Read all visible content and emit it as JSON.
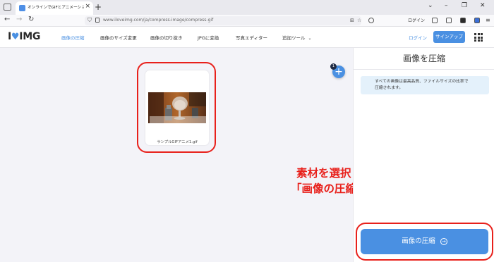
{
  "browser": {
    "tab_title": "オンラインでGIFとアニメーションGIFを...",
    "url": "www.iloveimg.com/ja/compress-image/compress-gif",
    "login_label": "ログイン"
  },
  "site": {
    "logo_text_1": "I",
    "logo_heart": "♥",
    "logo_text_2": "IMG",
    "nav": [
      {
        "label": "画像の圧縮",
        "active": true
      },
      {
        "label": "画像のサイズ変更"
      },
      {
        "label": "画像の切り抜き"
      },
      {
        "label": "JPGに変換"
      },
      {
        "label": "写真エディター"
      },
      {
        "label": "追加ツール"
      }
    ],
    "login_label": "ログイン",
    "signup_label": "サインアップ"
  },
  "workspace": {
    "file_name": "サンプルGIFアニメ1.gif",
    "file_count_badge": "1",
    "add_label": "+"
  },
  "annotation": {
    "line1": "素材を選択し",
    "line2": "「画像の圧縮」をクリック"
  },
  "sidebar": {
    "title": "画像を圧縮",
    "info_line1": "すべての画像は最高品質、ファイルサイズの比率で",
    "info_line2": "圧縮されます。",
    "compress_button": "画像の圧縮"
  },
  "colors": {
    "accent": "#4a90e2",
    "annotation_red": "#e8201b"
  }
}
